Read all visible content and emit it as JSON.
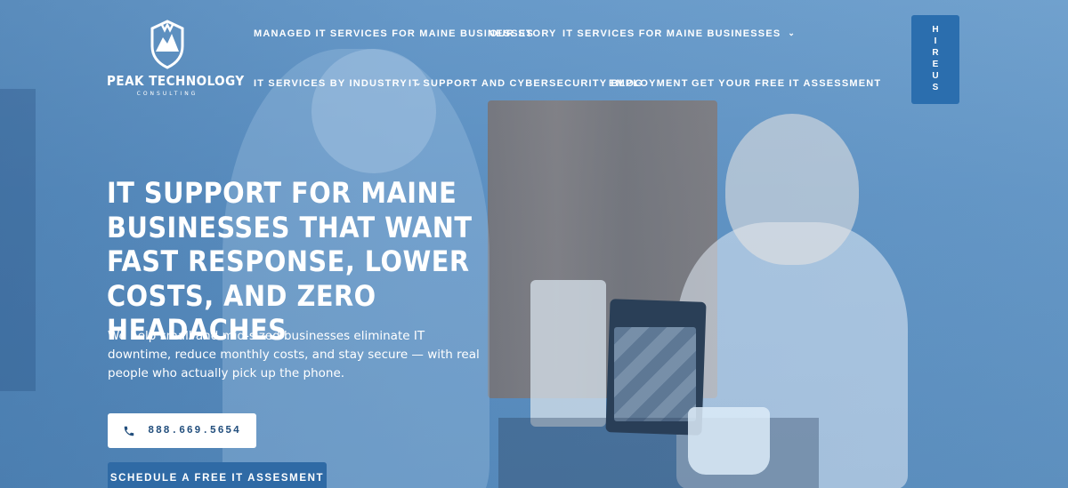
{
  "brand": {
    "name": "PEAK TECHNOLOGY",
    "tagline": "CONSULTING"
  },
  "nav": {
    "managed": "MANAGED IT SERVICES FOR MAINE BUSINESSES",
    "story": "OUR STORY",
    "services": "IT SERVICES FOR MAINE BUSINESSES",
    "industry": "IT SERVICES BY INDUSTRY",
    "blog": "IT SUPPORT AND CYBERSECURITY BLOG",
    "employment": "EMPLOYMENT",
    "assessment": "GET YOUR FREE IT ASSESSMENT"
  },
  "hire_tab": "HIREUS",
  "hero": {
    "headline": "IT Support for Maine Businesses That Want Fast Response, Lower Costs, and Zero Headaches",
    "subtext": "We help small and mid-sized businesses eliminate IT downtime, reduce monthly costs, and stay secure — with real people who actually pick up the phone.",
    "phone": "888.669.5654",
    "cta": "SCHEDULE A FREE IT ASSESMENT"
  },
  "icons": {
    "logo": "mountain-shield-icon",
    "phone": "phone-icon",
    "chevron": "chevron-down-icon"
  },
  "colors": {
    "accent": "#2b6eae",
    "overlay": "#5b8fbf",
    "button_text": "#24507e"
  }
}
